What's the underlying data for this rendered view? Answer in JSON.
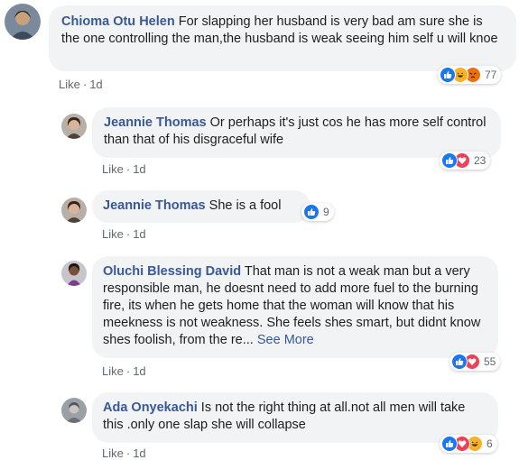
{
  "comments": [
    {
      "author": "Chioma Otu Helen",
      "text": "For slapping her husband is very bad am sure she is the one controlling the man,the husband is weak seeing him self u will knoe",
      "like_label": "Like",
      "time": "1d",
      "reactions": [
        "like",
        "haha",
        "angry"
      ],
      "reaction_count": "77"
    },
    {
      "author": "Jeannie Thomas",
      "text": "Or perhaps it's just cos he has more self control than that of his disgraceful wife",
      "like_label": "Like",
      "time": "1d",
      "reactions": [
        "like",
        "love"
      ],
      "reaction_count": "23"
    },
    {
      "author": "Jeannie Thomas",
      "text": "She is a fool",
      "like_label": "Like",
      "time": "1d",
      "reactions": [
        "like"
      ],
      "reaction_count": "9"
    },
    {
      "author": "Oluchi Blessing David",
      "text": "That man is not a weak man but a very responsible man, he doesnt need to add more fuel to the burning fire, its when he gets home that the woman will know that his meekness is not weakness. She feels shes smart, but didnt know shes foolish, from the re...",
      "see_more": "See More",
      "like_label": "Like",
      "time": "1d",
      "reactions": [
        "like",
        "love"
      ],
      "reaction_count": "55"
    },
    {
      "author": "Ada Onyekachi",
      "text": "Is not the right thing at all.not all men will take this .only one slap she will collapse",
      "like_label": "Like",
      "time": "1d",
      "reactions": [
        "like",
        "love",
        "haha"
      ],
      "reaction_count": "6"
    }
  ],
  "colors": {
    "like": "#1877f2",
    "love": "#f33e58",
    "haha": "#f7b125",
    "angry": "#e9710f",
    "name": "#385898",
    "bubble": "#f2f3f5"
  }
}
